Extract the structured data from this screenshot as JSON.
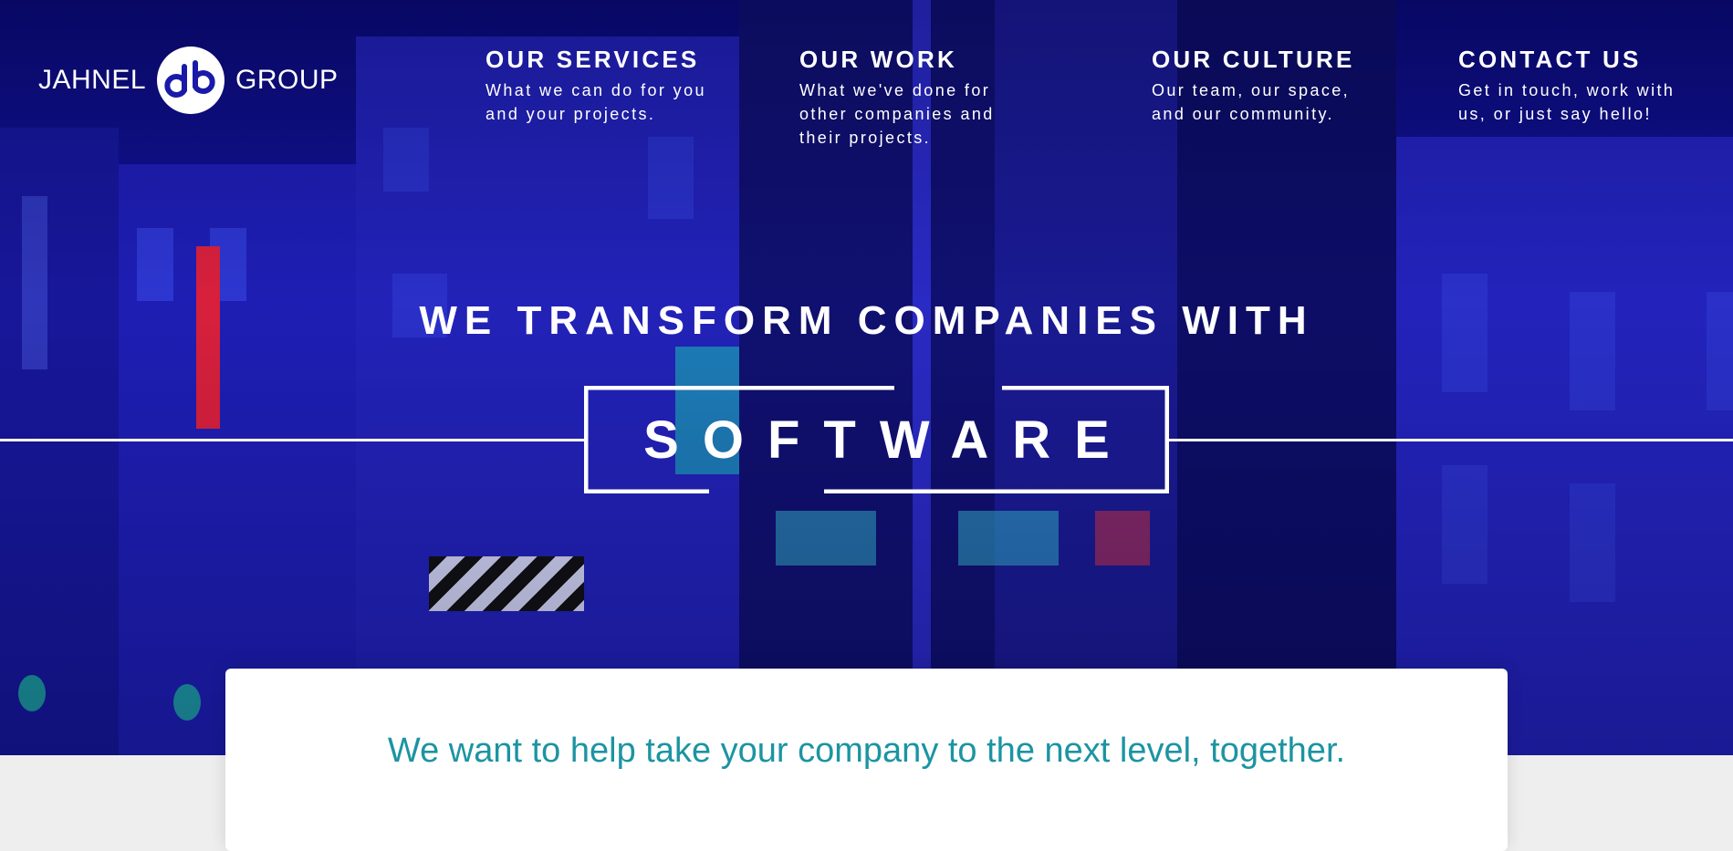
{
  "brand": {
    "name_left": "JAHNEL",
    "name_right": "GROUP",
    "logo_icon": "jg-monogram-icon"
  },
  "nav": [
    {
      "title": "OUR SERVICES",
      "desc": "What we can do for you and your projects."
    },
    {
      "title": "OUR WORK",
      "desc": "What we've done for other companies and their projects."
    },
    {
      "title": "OUR CULTURE",
      "desc": "Our team, our space, and our community."
    },
    {
      "title": "CONTACT US",
      "desc": "Get in touch, work with us, or just say hello!"
    }
  ],
  "hero": {
    "headline": "WE TRANSFORM COMPANIES WITH",
    "highlight_word": "SOFTWARE"
  },
  "intro": {
    "text": "We want to help take your company to the next level, together."
  },
  "colors": {
    "hero_blue": "#1a1aa8",
    "accent_teal": "#1c94a2",
    "text_white": "#ffffff"
  }
}
